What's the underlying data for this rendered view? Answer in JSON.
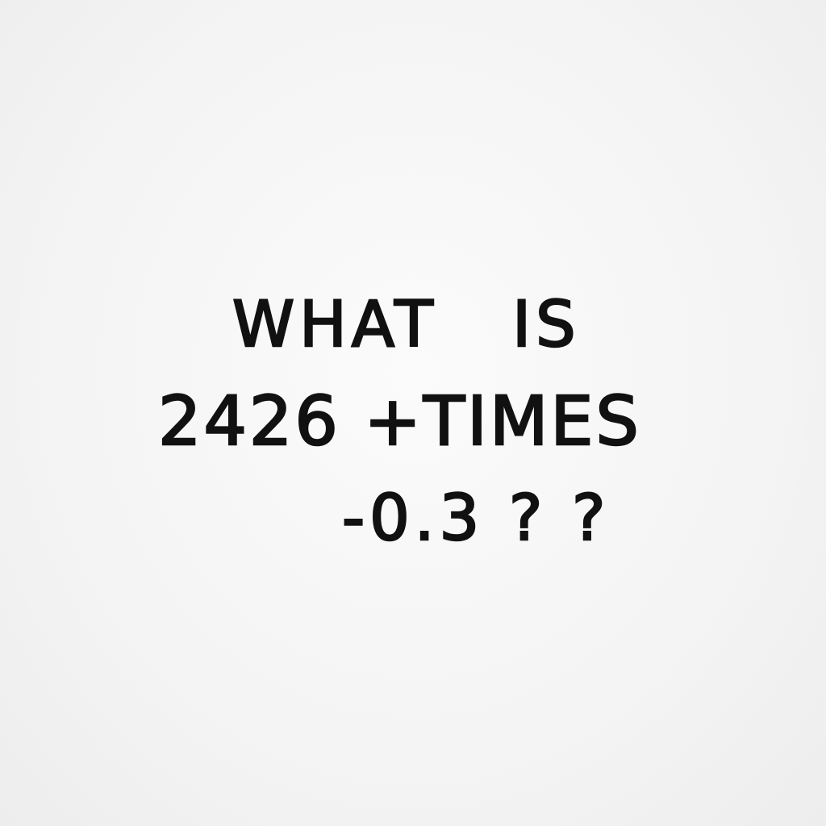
{
  "note": {
    "line1": "WHAT   IS",
    "line2": "2426 +TIMES",
    "line3": "-0.3 ? ?"
  },
  "colors": {
    "ink": "#111111",
    "paper": "#f6f6f6"
  }
}
